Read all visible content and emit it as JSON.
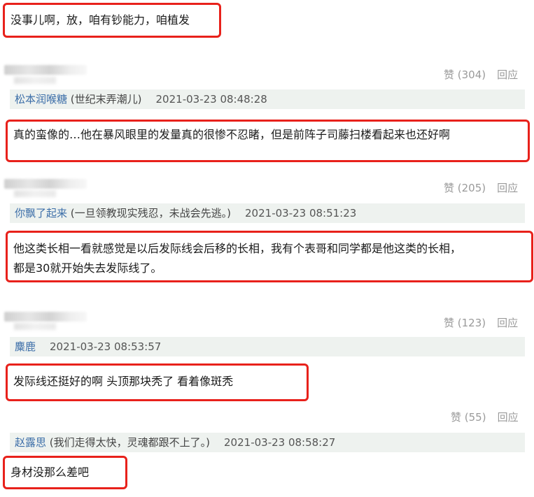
{
  "top_comment": {
    "text": "没事儿啊，放，咱有钞能力，咱植发"
  },
  "comments": [
    {
      "likes_label": "赞 (304)",
      "reply_label": "回应",
      "username": "松本润喉糖",
      "signature": "(世纪末弄潮儿)",
      "time": "2021-03-23 08:48:28",
      "text": "真的蛮像的…他在暴风眼里的发量真的很惨不忍睹，但是前阵子司藤扫楼看起来也还好啊"
    },
    {
      "likes_label": "赞 (205)",
      "reply_label": "回应",
      "username": "你飘了起来",
      "signature": "(一旦领教现实残忍，未战会先逃。)",
      "time": "2021-03-23 08:51:23",
      "text_line1": "他这类长相一看就感觉是以后发际线会后移的长相，我有个表哥和同学都是他这类的长相，",
      "text_line2": "都是30就开始失去发际线了。"
    },
    {
      "likes_label": "赞 (123)",
      "reply_label": "回应",
      "username": "麋鹿",
      "signature": "",
      "time": "2021-03-23 08:53:57",
      "text": "发际线还挺好的啊 头顶那块秃了 看着像斑秃"
    },
    {
      "likes_label": "赞 (55)",
      "reply_label": "回应",
      "username": "赵露思",
      "signature": "(我们走得太快，灵魂都跟不上了。)",
      "time": "2021-03-23 08:58:27",
      "text": "身材没那么差吧"
    }
  ]
}
